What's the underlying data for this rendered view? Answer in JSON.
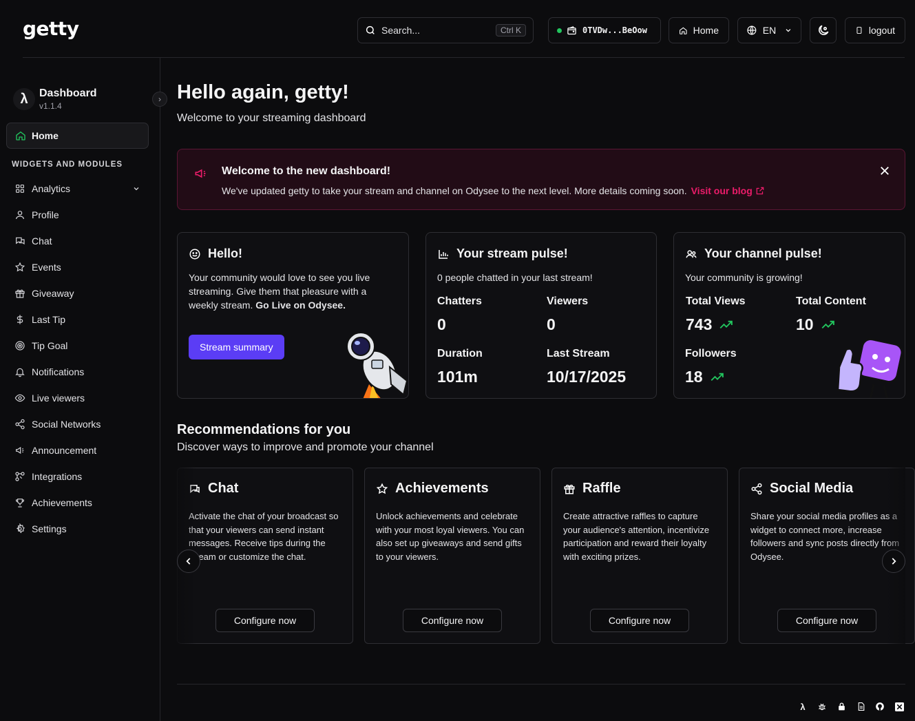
{
  "header": {
    "logo": "getty",
    "search_placeholder": "Search...",
    "search_shortcut": "Ctrl K",
    "wallet": "0TVDw...BeOow",
    "home": "Home",
    "language": "EN",
    "logout": "logout"
  },
  "sidebar": {
    "brand_title": "Dashboard",
    "brand_version": "v1.1.4",
    "brand_glyph": "λ",
    "home": "Home",
    "section": "WIDGETS AND MODULES",
    "items": [
      {
        "label": "Analytics",
        "icon": "grid-icon"
      },
      {
        "label": "Profile",
        "icon": "user-icon"
      },
      {
        "label": "Chat",
        "icon": "chat-icon"
      },
      {
        "label": "Events",
        "icon": "star-icon"
      },
      {
        "label": "Giveaway",
        "icon": "gift-icon"
      },
      {
        "label": "Last Tip",
        "icon": "dollar-icon"
      },
      {
        "label": "Tip Goal",
        "icon": "target-icon"
      },
      {
        "label": "Notifications",
        "icon": "bell-icon"
      },
      {
        "label": "Live viewers",
        "icon": "eye-icon"
      },
      {
        "label": "Social Networks",
        "icon": "share-icon"
      },
      {
        "label": "Announcement",
        "icon": "megaphone-icon"
      },
      {
        "label": "Integrations",
        "icon": "integrations-icon"
      },
      {
        "label": "Achievements",
        "icon": "trophy-icon"
      },
      {
        "label": "Settings",
        "icon": "gear-icon"
      }
    ]
  },
  "main": {
    "title": "Hello again, getty!",
    "subtitle": "Welcome to your streaming dashboard",
    "banner": {
      "title": "Welcome to the new dashboard!",
      "text": "We've updated getty to take your stream and channel on Odysee to the next level. More details coming soon.",
      "link": "Visit our blog",
      "accent": "#ec1c6a"
    },
    "hello_card": {
      "title": "Hello!",
      "text": "Your community would love to see you live streaming. Give them that pleasure with a weekly stream.",
      "cta_bold": "Go Live on Odysee.",
      "button": "Stream summary"
    },
    "stream_card": {
      "title": "Your stream pulse!",
      "subtitle": "0 people chatted in your last stream!",
      "chatters_label": "Chatters",
      "chatters": "0",
      "viewers_label": "Viewers",
      "viewers": "0",
      "duration_label": "Duration",
      "duration": "101m",
      "last_label": "Last Stream",
      "last": "10/17/2025"
    },
    "channel_card": {
      "title": "Your channel pulse!",
      "subtitle": "Your community is growing!",
      "views_label": "Total Views",
      "views": "743",
      "content_label": "Total Content",
      "content": "10",
      "followers_label": "Followers",
      "followers": "18"
    },
    "recommendations": {
      "title": "Recommendations for you",
      "subtitle": "Discover ways to improve and promote your channel",
      "items": [
        {
          "title": "Chat",
          "desc": "Activate the chat of your broadcast so that your viewers can send instant messages. Receive tips during the stream or customize the chat.",
          "button": "Configure now"
        },
        {
          "title": "Achievements",
          "desc": "Unlock achievements and celebrate with your most loyal viewers. You can also set up giveaways and send gifts to your viewers.",
          "button": "Configure now"
        },
        {
          "title": "Raffle",
          "desc": "Create attractive raffles to capture your audience's attention, incentivize participation and reward their loyalty with exciting prizes.",
          "button": "Configure now"
        },
        {
          "title": "Social Media",
          "desc": "Share your social media profiles as a widget to connect more, increase followers and sync posts directly from Odysee.",
          "button": "Configure now"
        }
      ]
    }
  },
  "colors": {
    "accent": "#5b3df5",
    "trend": "#22c55e",
    "online": "#22c55e"
  }
}
